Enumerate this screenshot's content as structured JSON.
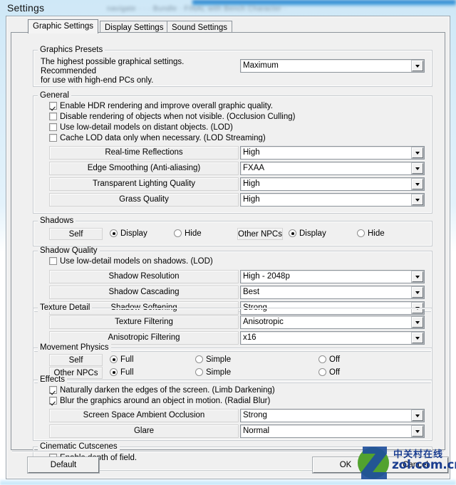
{
  "page": {
    "title": "Settings",
    "backdrop_blur_text": "navigate  ·  ·  ·  Bundle  ·  FINAL with Bench Character  ·"
  },
  "tabs": [
    {
      "label": "Graphic Settings",
      "active": true
    },
    {
      "label": "Display Settings",
      "active": false
    },
    {
      "label": "Sound Settings",
      "active": false
    }
  ],
  "groups": {
    "presets": {
      "label": "Graphics Presets",
      "description": "The highest possible graphical settings. Recommended\nfor use with high-end PCs only.",
      "combo_value": "Maximum"
    },
    "general": {
      "label": "General",
      "checkboxes": [
        {
          "label": "Enable HDR rendering and improve overall graphic quality.",
          "checked": true
        },
        {
          "label": "Disable rendering of objects when not visible. (Occlusion Culling)",
          "checked": false
        },
        {
          "label": "Use low-detail models on distant objects. (LOD)",
          "checked": false
        },
        {
          "label": "Cache LOD data only when necessary. (LOD Streaming)",
          "checked": false
        }
      ],
      "rows": [
        {
          "label": "Real-time Reflections",
          "value": "High"
        },
        {
          "label": "Edge Smoothing (Anti-aliasing)",
          "value": "FXAA"
        },
        {
          "label": "Transparent Lighting Quality",
          "value": "High"
        },
        {
          "label": "Grass Quality",
          "value": "High"
        }
      ]
    },
    "shadows": {
      "label": "Shadows",
      "self_label": "Self",
      "self_options": [
        {
          "label": "Display",
          "selected": true
        },
        {
          "label": "Hide",
          "selected": false
        }
      ],
      "npc_label": "Other NPCs",
      "npc_options": [
        {
          "label": "Display",
          "selected": true
        },
        {
          "label": "Hide",
          "selected": false
        }
      ]
    },
    "shadow_quality": {
      "label": "Shadow Quality",
      "checkboxes": [
        {
          "label": "Use low-detail models on shadows. (LOD)",
          "checked": false
        }
      ],
      "rows": [
        {
          "label": "Shadow Resolution",
          "value": "High - 2048p"
        },
        {
          "label": "Shadow Cascading",
          "value": "Best"
        },
        {
          "label": "Shadow Softening",
          "value": "Strong"
        }
      ]
    },
    "texture_detail": {
      "label": "Texture Detail",
      "rows": [
        {
          "label": "Texture Filtering",
          "value": "Anisotropic"
        },
        {
          "label": "Anisotropic Filtering",
          "value": "x16"
        }
      ]
    },
    "movement_physics": {
      "label": "Movement Physics",
      "self_label": "Self",
      "self_options": [
        {
          "label": "Full",
          "selected": true
        },
        {
          "label": "Simple",
          "selected": false
        },
        {
          "label": "Off",
          "selected": false
        }
      ],
      "npc_label": "Other NPCs",
      "npc_options": [
        {
          "label": "Full",
          "selected": true
        },
        {
          "label": "Simple",
          "selected": false
        },
        {
          "label": "Off",
          "selected": false
        }
      ]
    },
    "effects": {
      "label": "Effects",
      "checkboxes": [
        {
          "label": "Naturally darken the edges of the screen. (Limb Darkening)",
          "checked": true
        },
        {
          "label": "Blur the graphics around an object in motion. (Radial Blur)",
          "checked": true
        }
      ],
      "rows": [
        {
          "label": "Screen Space Ambient Occlusion",
          "value": "Strong"
        },
        {
          "label": "Glare",
          "value": "Normal"
        }
      ]
    },
    "cinematic": {
      "label": "Cinematic Cutscenes",
      "checkboxes": [
        {
          "label": "Enable depth of field.",
          "checked": true
        }
      ]
    }
  },
  "buttons": {
    "default": "Default",
    "ok": "OK",
    "cancel": "Cancel"
  },
  "watermark": {
    "cn": "中关村在线",
    "en": "zol.com.cn",
    "green": "#5aa832",
    "blue": "#1f4f9c"
  }
}
